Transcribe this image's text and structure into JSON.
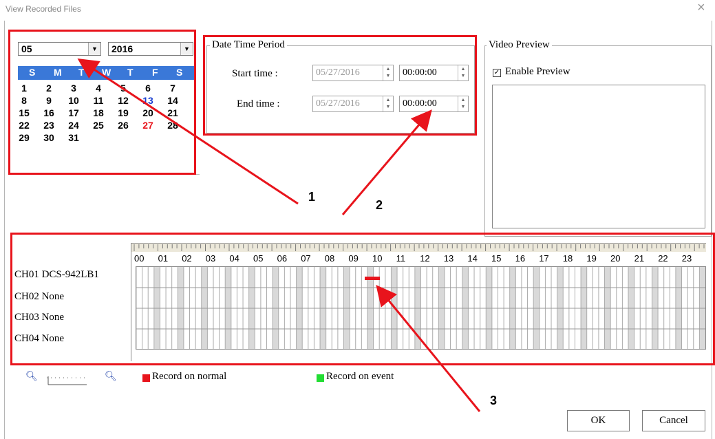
{
  "window": {
    "title": "View Recorded Files",
    "close_glyph": "×"
  },
  "calendar": {
    "month": "05",
    "year": "2016",
    "weekdays": [
      "S",
      "M",
      "T",
      "W",
      "T",
      "F",
      "S"
    ],
    "weeks": [
      [
        "1",
        "2",
        "3",
        "4",
        "5",
        "6",
        "7"
      ],
      [
        "8",
        "9",
        "10",
        "11",
        "12",
        "13",
        "14"
      ],
      [
        "15",
        "16",
        "17",
        "18",
        "19",
        "20",
        "21"
      ],
      [
        "22",
        "23",
        "24",
        "25",
        "26",
        "27",
        "28"
      ],
      [
        "29",
        "30",
        "31",
        "",
        "",
        "",
        ""
      ]
    ],
    "today_color": "#1b3fd0",
    "selected_color": "#e8141c"
  },
  "date_time_period": {
    "label": "Date Time Period",
    "start_label": "Start time :",
    "start_date": "05/27/2016",
    "start_time": "00:00:00",
    "end_label": "End time :",
    "end_date": "05/27/2016",
    "end_time": "00:00:00"
  },
  "video_preview": {
    "label": "Video Preview",
    "enable_label": "Enable Preview",
    "enabled": true
  },
  "timeline": {
    "hours": [
      "00",
      "01",
      "02",
      "03",
      "04",
      "05",
      "06",
      "07",
      "08",
      "09",
      "10",
      "11",
      "12",
      "13",
      "14",
      "15",
      "16",
      "17",
      "18",
      "19",
      "20",
      "21",
      "22",
      "23"
    ],
    "channels": [
      "CH01 DCS-942LB1",
      "CH02 None",
      "CH03 None",
      "CH04 None"
    ],
    "record_color_normal": "#e8141c",
    "record_color_event": "#22dd33"
  },
  "legend": {
    "normal": "Record on normal",
    "event": "Record on event"
  },
  "buttons": {
    "ok": "OK",
    "cancel": "Cancel"
  },
  "annotations": {
    "n1": "1",
    "n2": "2",
    "n3": "3"
  }
}
